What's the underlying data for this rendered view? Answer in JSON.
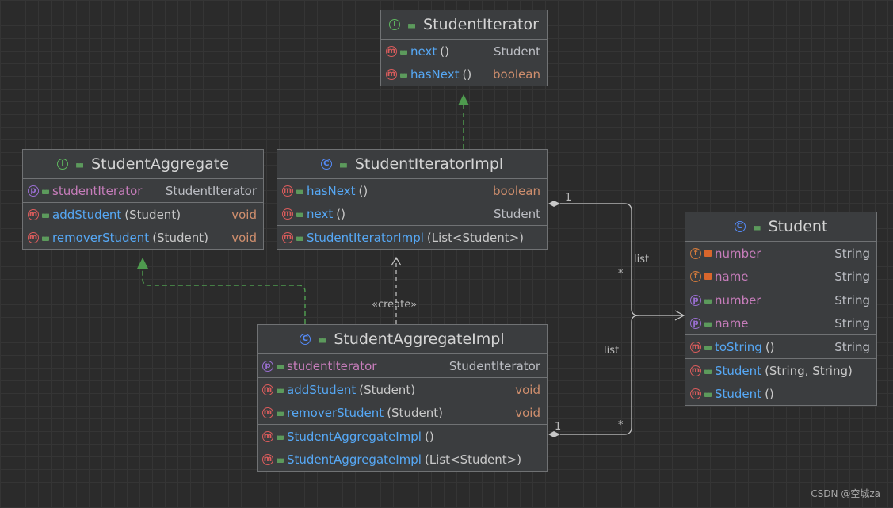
{
  "classes": {
    "student_iterator": {
      "kind": "I",
      "name": "StudentIterator",
      "sections": [
        [
          {
            "kind": "m",
            "name": "next",
            "params": "()",
            "type": "Student",
            "type_style": "plain"
          },
          {
            "kind": "m",
            "name": "hasNext",
            "params": "()",
            "type": "boolean",
            "type_style": "kw"
          }
        ]
      ]
    },
    "student_aggregate": {
      "kind": "I",
      "name": "StudentAggregate",
      "sections": [
        [
          {
            "kind": "p",
            "name": "studentIterator",
            "params": "",
            "type": "StudentIterator",
            "type_style": "plain"
          }
        ],
        [
          {
            "kind": "m",
            "name": "addStudent",
            "params": "(Student)",
            "type": "void",
            "type_style": "kw"
          },
          {
            "kind": "m",
            "name": "removerStudent",
            "params": "(Student)",
            "type": "void",
            "type_style": "kw"
          }
        ]
      ]
    },
    "student_iterator_impl": {
      "kind": "C",
      "name": "StudentIteratorImpl",
      "sections": [
        [
          {
            "kind": "m",
            "name": "hasNext",
            "params": "()",
            "type": "boolean",
            "type_style": "kw"
          },
          {
            "kind": "m",
            "name": "next",
            "params": "()",
            "type": "Student",
            "type_style": "plain"
          }
        ],
        [
          {
            "kind": "m",
            "name": "StudentIteratorImpl",
            "params": "(List<Student>)",
            "type": "",
            "type_style": "plain"
          }
        ]
      ]
    },
    "student": {
      "kind": "C",
      "name": "Student",
      "sections": [
        [
          {
            "kind": "f",
            "vis": "private",
            "name": "number",
            "params": "",
            "type": "String",
            "type_style": "plain"
          },
          {
            "kind": "f",
            "vis": "private",
            "name": "name",
            "params": "",
            "type": "String",
            "type_style": "plain"
          }
        ],
        [
          {
            "kind": "p",
            "name": "number",
            "params": "",
            "type": "String",
            "type_style": "plain"
          },
          {
            "kind": "p",
            "name": "name",
            "params": "",
            "type": "String",
            "type_style": "plain"
          }
        ],
        [
          {
            "kind": "m",
            "name": "toString",
            "params": "()",
            "type": "String",
            "type_style": "plain"
          }
        ],
        [
          {
            "kind": "m",
            "name": "Student",
            "params": "(String, String)",
            "type": "",
            "type_style": "plain"
          },
          {
            "kind": "m",
            "name": "Student",
            "params": "()",
            "type": "",
            "type_style": "plain"
          }
        ]
      ]
    },
    "student_aggregate_impl": {
      "kind": "C",
      "name": "StudentAggregateImpl",
      "sections": [
        [
          {
            "kind": "p",
            "name": "studentIterator",
            "params": "",
            "type": "StudentIterator",
            "type_style": "plain"
          }
        ],
        [
          {
            "kind": "m",
            "name": "addStudent",
            "params": "(Student)",
            "type": "void",
            "type_style": "kw"
          },
          {
            "kind": "m",
            "name": "removerStudent",
            "params": "(Student)",
            "type": "void",
            "type_style": "kw"
          }
        ],
        [
          {
            "kind": "m",
            "name": "StudentAggregateImpl",
            "params": "()",
            "type": "",
            "type_style": "plain"
          },
          {
            "kind": "m",
            "name": "StudentAggregateImpl",
            "params": "(List<Student>)",
            "type": "",
            "type_style": "plain"
          }
        ]
      ]
    }
  },
  "edge_labels": {
    "create": "«create»",
    "list_top": "list",
    "list_bottom": "list",
    "one_top": "1",
    "many_top": "*",
    "one_bottom": "1",
    "many_bottom": "*"
  },
  "colors": {
    "realization": "#4e9a4e",
    "dependency": "#c8c8c8",
    "association": "#c8c8c8"
  },
  "watermark": "CSDN @空城za"
}
